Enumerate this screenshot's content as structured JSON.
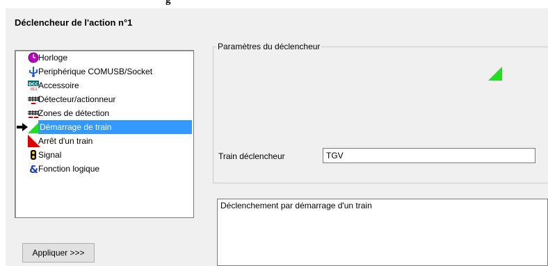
{
  "top_fragment": "g",
  "dialog": {
    "title": "Déclencheur de l'action n°1"
  },
  "trigger_list": {
    "items": [
      {
        "label": "Horloge",
        "icon": "clock-icon"
      },
      {
        "label": "Periphérique COMUSB/Socket",
        "icon": "usb-icon"
      },
      {
        "label": "Accessoire",
        "icon": "dcc-accessory-icon"
      },
      {
        "label": "Détecteur/actionneur",
        "icon": "track-detector-icon"
      },
      {
        "label": "Zones de détection",
        "icon": "detection-zone-icon"
      },
      {
        "label": "Démarrage de train",
        "icon": "green-triangle-icon",
        "selected": true
      },
      {
        "label": "Arrêt d'un train",
        "icon": "red-triangle-icon"
      },
      {
        "label": "Signal",
        "icon": "signal-icon"
      },
      {
        "label": "Fonction logique",
        "icon": "ampersand-icon"
      }
    ]
  },
  "params": {
    "legend": "Paramètres du déclencheur",
    "train_label": "Train déclencheur",
    "train_value": "TGV"
  },
  "description": "Déclenchement par démarrage d'un train",
  "apply_button": "Appliquer >>>"
}
